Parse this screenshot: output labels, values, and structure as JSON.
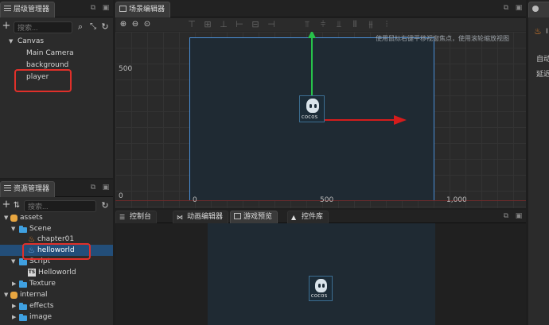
{
  "hierarchy": {
    "title": "层级管理器",
    "search_placeholder": "搜索...",
    "items": [
      {
        "label": "Canvas"
      },
      {
        "label": "Main Camera"
      },
      {
        "label": "background"
      },
      {
        "label": "player"
      }
    ]
  },
  "assets": {
    "title": "资源管理器",
    "search_placeholder": "搜索...",
    "items": [
      {
        "label": "assets"
      },
      {
        "label": "Scene"
      },
      {
        "label": "chapter01"
      },
      {
        "label": "helloworld"
      },
      {
        "label": "Script"
      },
      {
        "label": "Helloworld"
      },
      {
        "label": "Texture"
      },
      {
        "label": "internal"
      },
      {
        "label": "effects"
      },
      {
        "label": "image"
      }
    ]
  },
  "scene": {
    "title": "场景编辑器",
    "hint": "使用鼠标右键平移视窗焦点，使用滚轮缩放视图",
    "y_label_500": "500",
    "y_label_0": "0",
    "x_label_0": "0",
    "x_label_500": "500",
    "x_label_1000": "1,000",
    "logo_text": "COCOS"
  },
  "bottom_tabs": {
    "console": "控制台",
    "animation": "动画编辑器",
    "preview": "游戏预览",
    "library": "控件库"
  },
  "inspector": {
    "title_fragment": "I",
    "line1": "自动",
    "line2": "延迟"
  },
  "colors": {
    "highlight_red": "#e0302a",
    "selection_blue": "#234e79",
    "canvas_border": "#4a8fd8",
    "axis_green": "#27c14a",
    "axis_red": "#d41c1c"
  }
}
